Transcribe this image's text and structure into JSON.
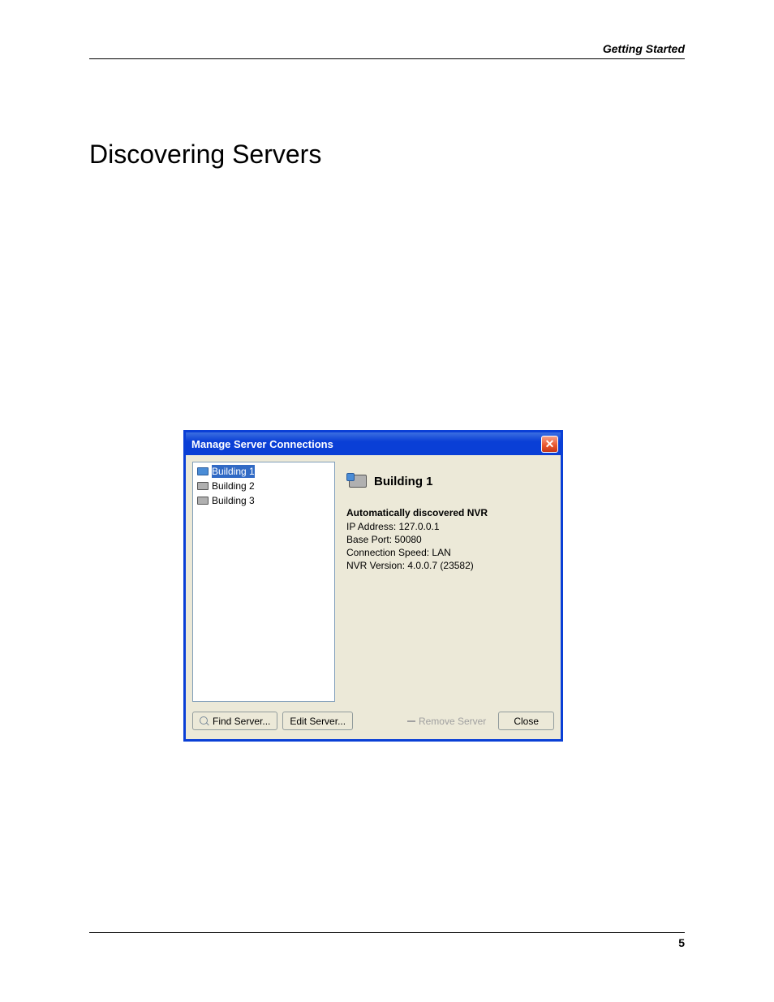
{
  "header": {
    "section": "Getting Started"
  },
  "chapter": {
    "title": "Discovering Servers"
  },
  "dialog": {
    "title": "Manage Server Connections",
    "close_glyph": "✕",
    "list": {
      "items": [
        {
          "label": "Building 1",
          "selected": true
        },
        {
          "label": "Building 2",
          "selected": false
        },
        {
          "label": "Building 3",
          "selected": false
        }
      ]
    },
    "detail": {
      "title": "Building 1",
      "subtitle": "Automatically discovered NVR",
      "lines": [
        "IP Address: 127.0.0.1",
        "Base Port: 50080",
        "Connection Speed: LAN",
        "NVR Version: 4.0.0.7 (23582)"
      ]
    },
    "buttons": {
      "find": "Find Server...",
      "edit": "Edit Server...",
      "remove": "Remove Server",
      "close": "Close"
    }
  },
  "footer": {
    "page_number": "5"
  }
}
